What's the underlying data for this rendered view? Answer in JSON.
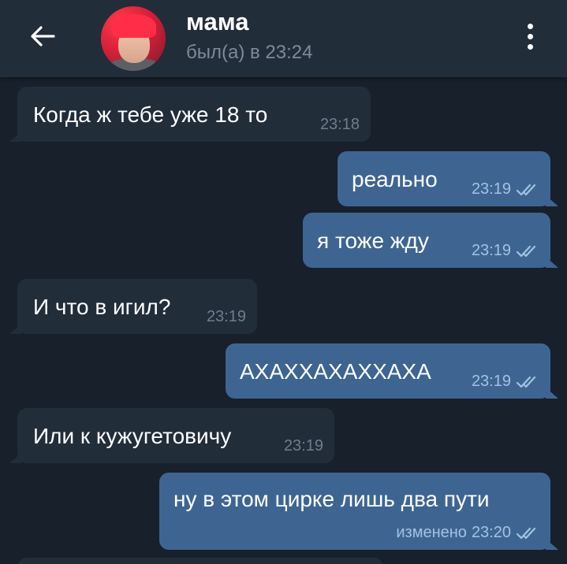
{
  "header": {
    "contact_name": "мама",
    "status": "был(а) в 23:24"
  },
  "colors": {
    "header_bg": "#222d3a",
    "chat_bg": "#17202b",
    "incoming_bubble": "#222d3a",
    "outgoing_bubble": "#3e6592",
    "read_check": "#a3c2e2"
  },
  "icons": {
    "back": "arrow-left-icon",
    "menu": "vertical-dots-icon",
    "read": "double-check-icon"
  },
  "messages": [
    {
      "direction": "incoming",
      "text": "Когда ж тебе уже 18 то",
      "time": "23:18"
    },
    {
      "direction": "outgoing",
      "text": "реально",
      "time": "23:19",
      "status": "read"
    },
    {
      "direction": "outgoing",
      "text": "я тоже жду",
      "time": "23:19",
      "status": "read"
    },
    {
      "direction": "incoming",
      "text": "И что в игил?",
      "time": "23:19"
    },
    {
      "direction": "outgoing",
      "text": "АХАХХАХАХХАХА",
      "time": "23:19",
      "status": "read"
    },
    {
      "direction": "incoming",
      "text": "Или к кужугетовичу",
      "time": "23:19"
    },
    {
      "direction": "outgoing",
      "text": "ну в этом цирке лишь два пути",
      "edited_label": "изменено",
      "time": "23:20",
      "status": "read"
    }
  ]
}
